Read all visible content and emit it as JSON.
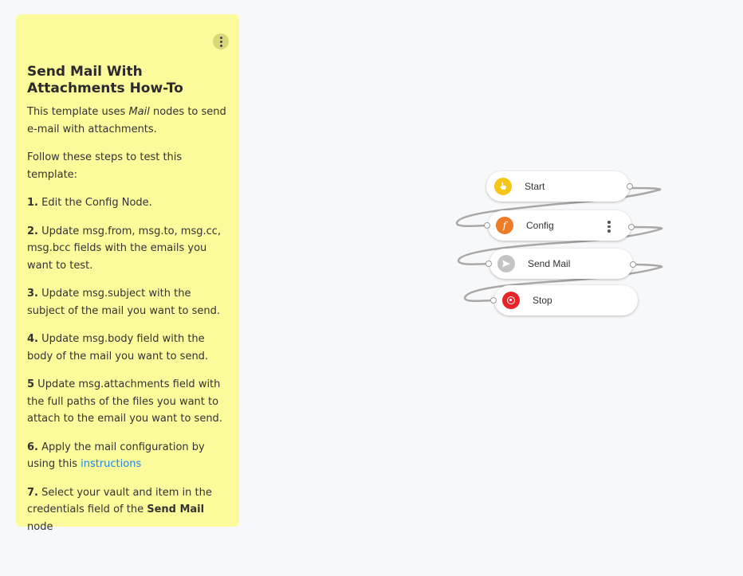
{
  "note": {
    "title": "Send Mail With Attachments How-To",
    "intro_before": "This template uses ",
    "intro_em": "Mail",
    "intro_after": " nodes to send e-mail with attachments.",
    "follow": "Follow these steps to test this template:",
    "steps": [
      {
        "num": "1.",
        "text": " Edit the Config Node."
      },
      {
        "num": "2.",
        "text": " Update msg.from, msg.to, msg.cc, msg.bcc fields with the emails you want to test."
      },
      {
        "num": "3.",
        "text": " Update msg.subject with the subject of the mail you want to send."
      },
      {
        "num": "4.",
        "text": " Update msg.body field with the body of the mail you want to send."
      },
      {
        "num": "5",
        "text": " Update msg.attachments field with the full paths of the files you want to attach to the email you want to send."
      },
      {
        "num": "6.",
        "text": " Apply the mail configuration by using this ",
        "link": "instructions"
      },
      {
        "num": "7.",
        "text": " Select your vault and item in the credentials field of the ",
        "bold": "Send Mail",
        "after": " node"
      }
    ]
  },
  "nodes": {
    "start": {
      "label": "Start",
      "icon": "hand-pointer-icon",
      "color": "#f5c518"
    },
    "config": {
      "label": "Config",
      "icon": "function-icon",
      "color": "#ee7b26"
    },
    "send_mail": {
      "label": "Send Mail",
      "icon": "paper-plane-icon",
      "color": "#c4c4c4"
    },
    "stop": {
      "label": "Stop",
      "icon": "stop-icon",
      "color": "#e8232a"
    }
  }
}
